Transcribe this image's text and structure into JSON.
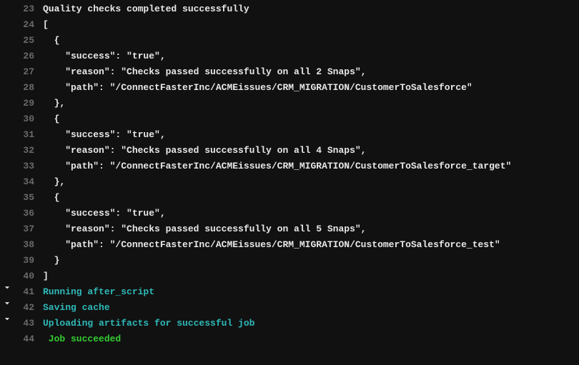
{
  "lines": [
    {
      "n": 23,
      "caret": false,
      "cls": "",
      "text": "Quality checks completed successfully"
    },
    {
      "n": 24,
      "caret": false,
      "cls": "",
      "text": "["
    },
    {
      "n": 25,
      "caret": false,
      "cls": "",
      "text": "  {"
    },
    {
      "n": 26,
      "caret": false,
      "cls": "",
      "text": "    \"success\": \"true\","
    },
    {
      "n": 27,
      "caret": false,
      "cls": "",
      "text": "    \"reason\": \"Checks passed successfully on all 2 Snaps\","
    },
    {
      "n": 28,
      "caret": false,
      "cls": "",
      "text": "    \"path\": \"/ConnectFasterInc/ACMEissues/CRM_MIGRATION/CustomerToSalesforce\""
    },
    {
      "n": 29,
      "caret": false,
      "cls": "",
      "text": "  },"
    },
    {
      "n": 30,
      "caret": false,
      "cls": "",
      "text": "  {"
    },
    {
      "n": 31,
      "caret": false,
      "cls": "",
      "text": "    \"success\": \"true\","
    },
    {
      "n": 32,
      "caret": false,
      "cls": "",
      "text": "    \"reason\": \"Checks passed successfully on all 4 Snaps\","
    },
    {
      "n": 33,
      "caret": false,
      "cls": "",
      "text": "    \"path\": \"/ConnectFasterInc/ACMEissues/CRM_MIGRATION/CustomerToSalesforce_target\""
    },
    {
      "n": 34,
      "caret": false,
      "cls": "",
      "text": "  },"
    },
    {
      "n": 35,
      "caret": false,
      "cls": "",
      "text": "  {"
    },
    {
      "n": 36,
      "caret": false,
      "cls": "",
      "text": "    \"success\": \"true\","
    },
    {
      "n": 37,
      "caret": false,
      "cls": "",
      "text": "    \"reason\": \"Checks passed successfully on all 5 Snaps\","
    },
    {
      "n": 38,
      "caret": false,
      "cls": "",
      "text": "    \"path\": \"/ConnectFasterInc/ACMEissues/CRM_MIGRATION/CustomerToSalesforce_test\""
    },
    {
      "n": 39,
      "caret": false,
      "cls": "",
      "text": "  }"
    },
    {
      "n": 40,
      "caret": false,
      "cls": "",
      "text": "]"
    },
    {
      "n": 41,
      "caret": true,
      "cls": "teal",
      "text": "Running after_script"
    },
    {
      "n": 42,
      "caret": true,
      "cls": "teal",
      "text": "Saving cache"
    },
    {
      "n": 43,
      "caret": true,
      "cls": "teal",
      "text": "Uploading artifacts for successful job"
    },
    {
      "n": 44,
      "caret": false,
      "cls": "green",
      "text": " Job succeeded"
    }
  ]
}
